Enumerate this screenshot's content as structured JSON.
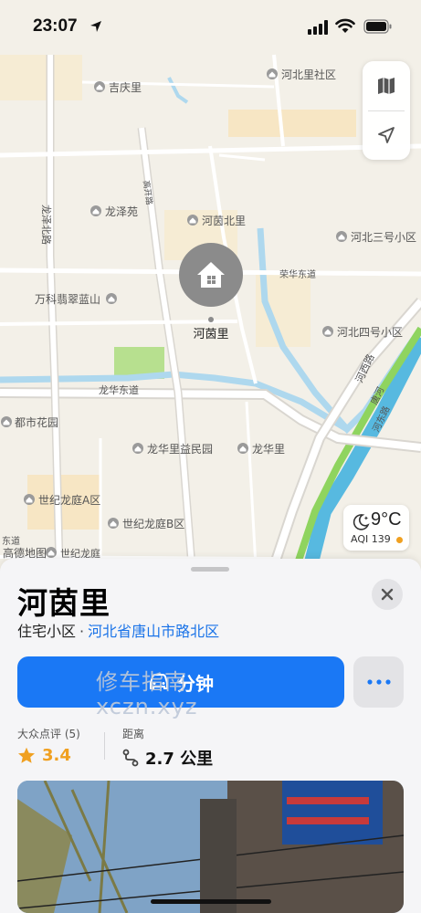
{
  "status": {
    "time": "23:07"
  },
  "map": {
    "labels": [
      "河北里社区",
      "吉庆里",
      "龙泽苑",
      "河茵北里",
      "河北三号小区",
      "万科翡翠蓝山",
      "河北四号小区",
      "都市花园",
      "龙华里益民园",
      "龙华里",
      "世纪龙庭A区",
      "世纪龙庭B区",
      "世纪龙庭"
    ],
    "road_labels": [
      "高开路",
      "龙泽北路",
      "荣华东道",
      "龙华东道",
      "河西路",
      "唐河",
      "河东路",
      "东道"
    ],
    "pin_label": "河茵里",
    "attribution": "高德地图"
  },
  "weather": {
    "temp": "9°C",
    "aqi": "AQI 139"
  },
  "sheet": {
    "title": "河茵里",
    "category": "住宅小区",
    "separator": "·",
    "address": "河北省唐山市路北区",
    "route_label": "分钟",
    "watermark_line1": "修车指南",
    "watermark_line2": "xczn.xyz",
    "rating_label": "大众点评 (5)",
    "rating_value": "3.4",
    "distance_label": "距离",
    "distance_value": "2.7 公里"
  },
  "colors": {
    "accent": "#1a78f5",
    "rating": "#f0a020",
    "link": "#1a73e8"
  },
  "icons": [
    "navigation-arrow-icon",
    "cellular-signal-icon",
    "wifi-icon",
    "battery-icon",
    "map-layers-icon",
    "location-arrow-icon",
    "moon-icon",
    "home-pin-icon",
    "close-icon",
    "car-icon",
    "more-icon",
    "star-icon",
    "route-icon"
  ]
}
